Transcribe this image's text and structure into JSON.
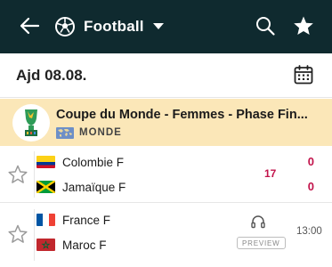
{
  "header": {
    "back_icon": "arrow-left-icon",
    "sport_icon": "soccer-ball-icon",
    "sport_label": "Football",
    "dropdown_icon": "caret-down-icon",
    "search_icon": "search-icon",
    "favorites_icon": "star-icon",
    "background": "#0f2a2f"
  },
  "date_bar": {
    "label": "Ajd 08.08.",
    "calendar_icon": "calendar-icon"
  },
  "league": {
    "name": "Coupe du Monde - Femmes - Phase Fin...",
    "region": "MONDE",
    "background": "#fbe7b8",
    "logo_icon": "trophy-logo-icon",
    "region_icon": "world-map-icon"
  },
  "matches": [
    {
      "favorite_icon": "star-outline-icon",
      "home": {
        "name": "Colombie F",
        "flag": "colombia-flag-icon",
        "score": "0"
      },
      "away": {
        "name": "Jamaïque F",
        "flag": "jamaica-flag-icon",
        "score": "0"
      },
      "minute": "17",
      "live_color": "#c2134b"
    },
    {
      "favorite_icon": "star-outline-icon",
      "home": {
        "name": "France F",
        "flag": "france-flag-icon"
      },
      "away": {
        "name": "Maroc F",
        "flag": "morocco-flag-icon"
      },
      "audio_icon": "headphones-icon",
      "preview_label": "PREVIEW",
      "kickoff": "13:00"
    }
  ]
}
